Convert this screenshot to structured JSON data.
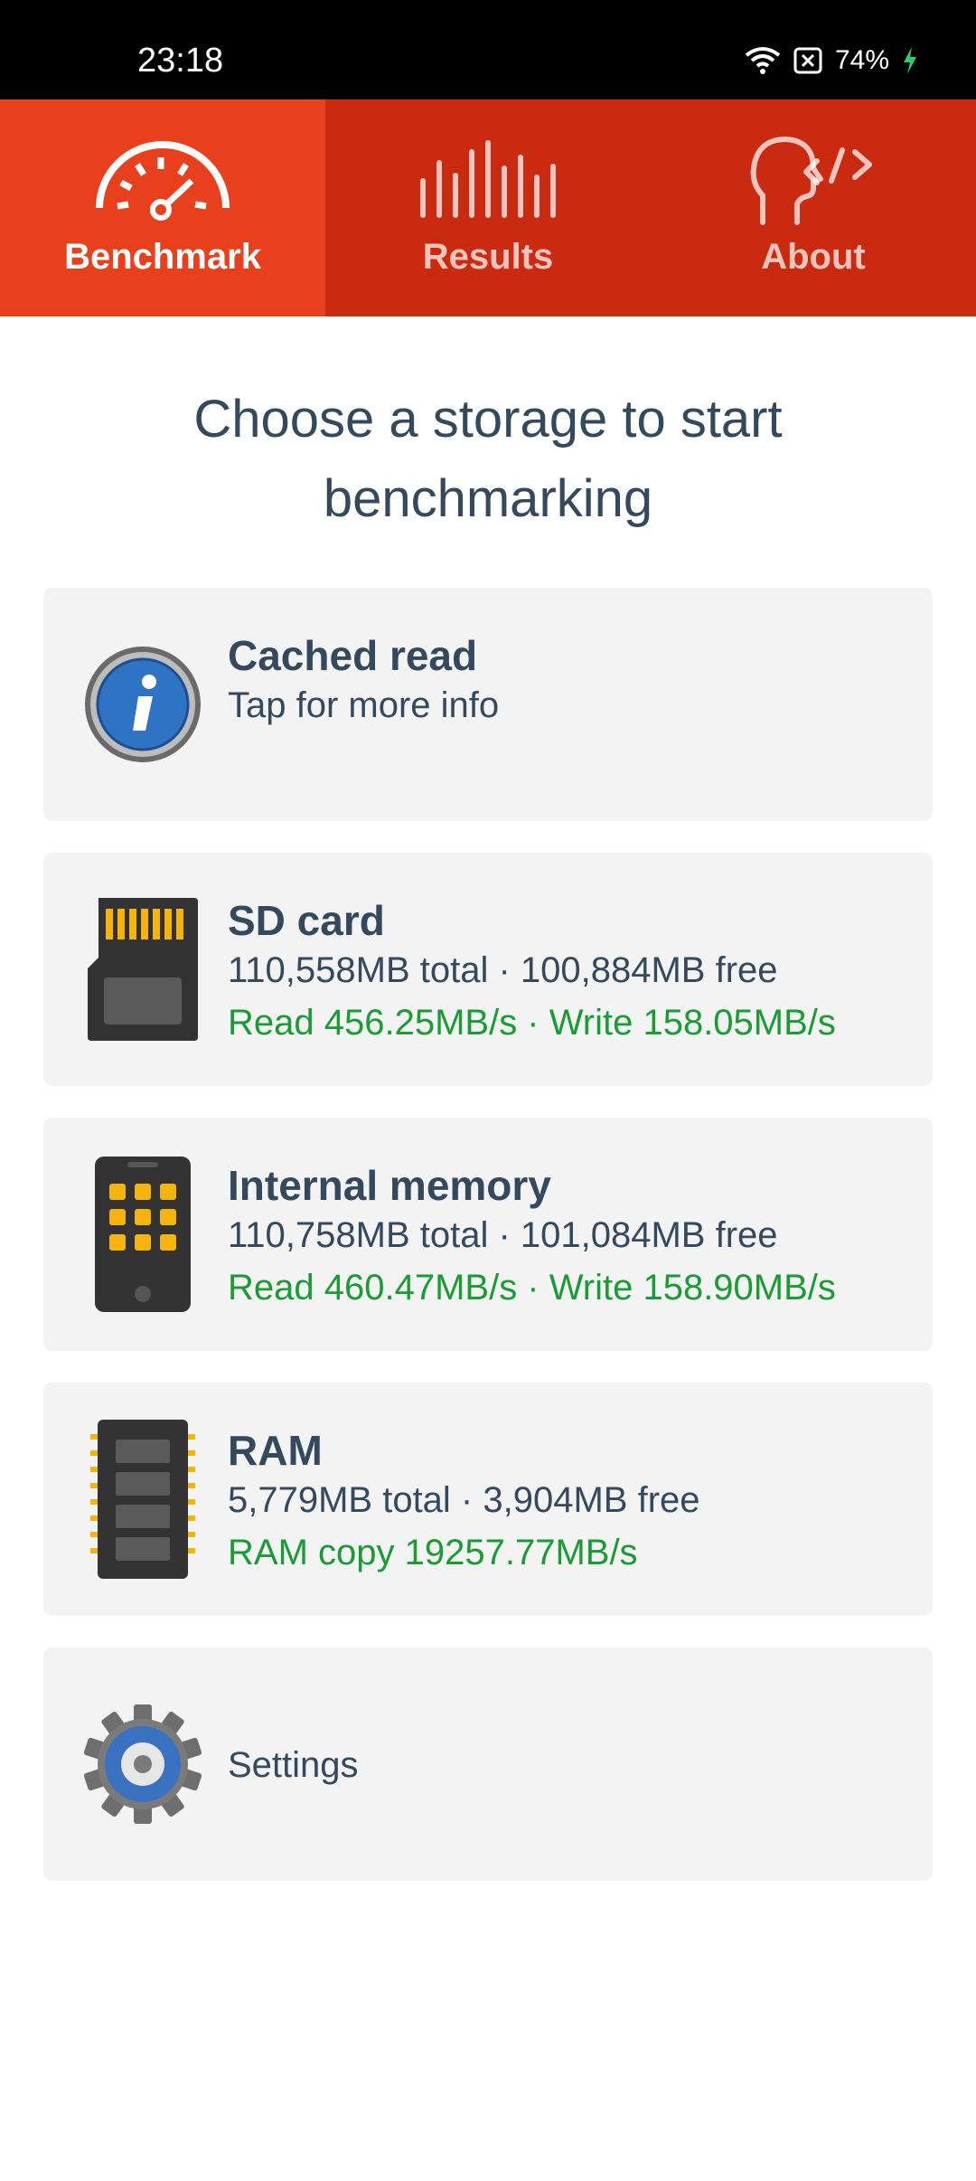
{
  "status": {
    "time": "23:18",
    "battery": "74%"
  },
  "tabs": [
    {
      "label": "Benchmark",
      "icon": "speedometer-icon",
      "active": true
    },
    {
      "label": "Results",
      "icon": "bars-icon",
      "active": false
    },
    {
      "label": "About",
      "icon": "head-code-icon",
      "active": false
    }
  ],
  "heading": "Choose a storage to start benchmarking",
  "cards": {
    "cached": {
      "title": "Cached read",
      "subtitle": "Tap for more info",
      "icon": "info-icon"
    },
    "sd": {
      "title": "SD card",
      "capacity": "110,558MB total · 100,884MB free",
      "speed": "Read 456.25MB/s · Write 158.05MB/s",
      "icon": "sd-card-icon"
    },
    "internal": {
      "title": "Internal memory",
      "capacity": "110,758MB total · 101,084MB free",
      "speed": "Read 460.47MB/s · Write 158.90MB/s",
      "icon": "phone-icon"
    },
    "ram": {
      "title": "RAM",
      "capacity": "5,779MB total · 3,904MB free",
      "speed": "RAM copy 19257.77MB/s",
      "icon": "ram-chip-icon"
    },
    "settings": {
      "title": "Settings",
      "icon": "gear-icon"
    }
  },
  "colors": {
    "tabbar": "#c92a10",
    "tab_active": "#e8401c",
    "speed_text": "#1a9b34",
    "text": "#34495e",
    "card_bg": "#f3f3f3"
  }
}
